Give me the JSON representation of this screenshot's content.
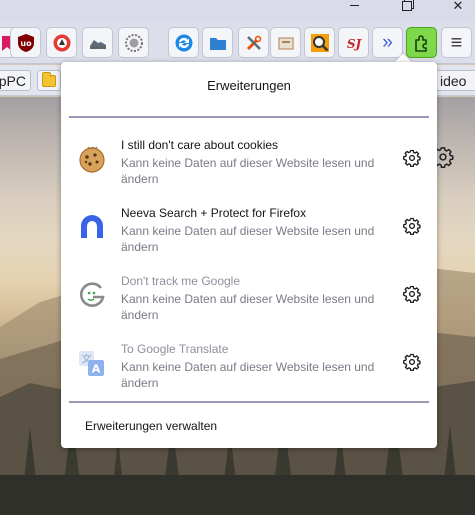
{
  "window": {
    "minimize_icon": "minimize-icon",
    "maximize_icon": "maximize-icon",
    "close_glyph": "✕"
  },
  "toolbar": {
    "buttons": [
      {
        "name": "bookmark-button",
        "icon": "bookmark-icon",
        "color": "#d81b60"
      },
      {
        "name": "ublock-button",
        "icon": "ublock-shield-icon",
        "color": "#800000"
      },
      {
        "name": "privacy-badger-button",
        "icon": "badger-icon",
        "color": "#e53935"
      },
      {
        "name": "sneaker-button",
        "icon": "shoe-icon",
        "color": "#5f6b7a"
      },
      {
        "name": "cookie-button",
        "icon": "cookie-round-icon",
        "color": "#757575"
      },
      {
        "name": "sync-button",
        "icon": "sync-icon",
        "color": "#1e88e5"
      },
      {
        "name": "folder-button",
        "icon": "folder-icon",
        "color": "#2f80d1"
      },
      {
        "name": "tools-button",
        "icon": "tools-icon",
        "color": "#e65100"
      },
      {
        "name": "archive-button",
        "icon": "archive-icon",
        "color": "#b08050"
      },
      {
        "name": "search-button",
        "icon": "magnifier-icon",
        "color": "#f59e0b"
      },
      {
        "name": "sj-button",
        "icon": "sj-logo-icon",
        "color": "#c62828"
      },
      {
        "name": "overflow-button",
        "icon": "chevrons-right-icon",
        "label": "»",
        "color": "#3d5fcf"
      },
      {
        "name": "extensions-button",
        "icon": "puzzle-icon",
        "color": "#1b5e20"
      },
      {
        "name": "menu-button",
        "icon": "hamburger-menu-icon",
        "label": "≡",
        "color": "#333"
      }
    ]
  },
  "bookmarks": {
    "items": [
      {
        "label": "npPC"
      },
      {
        "label": "",
        "icon": "folder-icon"
      },
      {
        "label": "ideo"
      }
    ]
  },
  "panel": {
    "title": "Erweiterungen",
    "extensions": [
      {
        "name": "I still don't care about cookies",
        "desc": "Kann keine Daten auf dieser Website lesen und ändern",
        "icon": "cookie-icon",
        "enabled": true
      },
      {
        "name": "Neeva Search + Protect for Firefox",
        "desc": "Kann keine Daten auf dieser Website lesen und ändern",
        "icon": "neeva-logo-icon",
        "enabled": true
      },
      {
        "name": "Don't track me Google",
        "desc": "Kann keine Daten auf dieser Website lesen und ändern",
        "icon": "google-g-icon",
        "enabled": false
      },
      {
        "name": "To Google Translate",
        "desc": "Kann keine Daten auf dieser Website lesen und ändern",
        "icon": "translate-icon",
        "enabled": false
      }
    ],
    "manage_label": "Erweiterungen verwalten"
  },
  "colors": {
    "accent": "#7dd84a",
    "divider": "#9a98b4",
    "neeva_blue": "#3a63e8"
  }
}
